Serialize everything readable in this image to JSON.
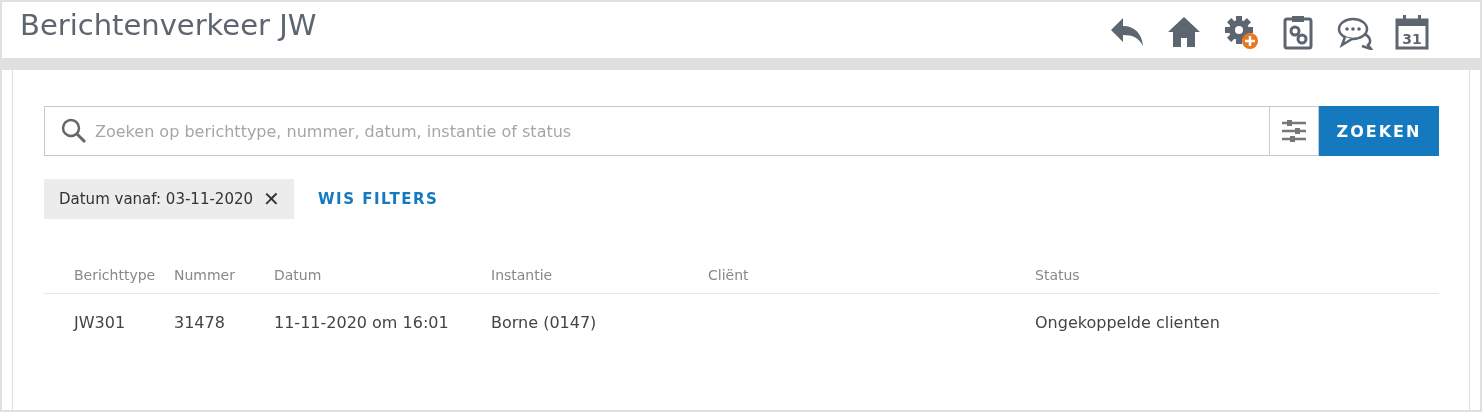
{
  "header": {
    "title": "Berichtenverkeer JW",
    "calendar_day": "31"
  },
  "search": {
    "placeholder": "Zoeken op berichttype, nummer, datum, instantie of status",
    "button": "ZOEKEN"
  },
  "filters": [
    {
      "label": "Datum vanaf: 03-11-2020",
      "remove": "✕"
    }
  ],
  "clear_filters": "WIS FILTERS",
  "table": {
    "columns": [
      "Berichttype",
      "Nummer",
      "Datum",
      "Instantie",
      "Cliënt",
      "Status"
    ],
    "rows": [
      [
        "JW301",
        "31478",
        "11-11-2020 om 16:01",
        "Borne (0147)",
        "",
        "Ongekoppelde clienten"
      ]
    ]
  }
}
